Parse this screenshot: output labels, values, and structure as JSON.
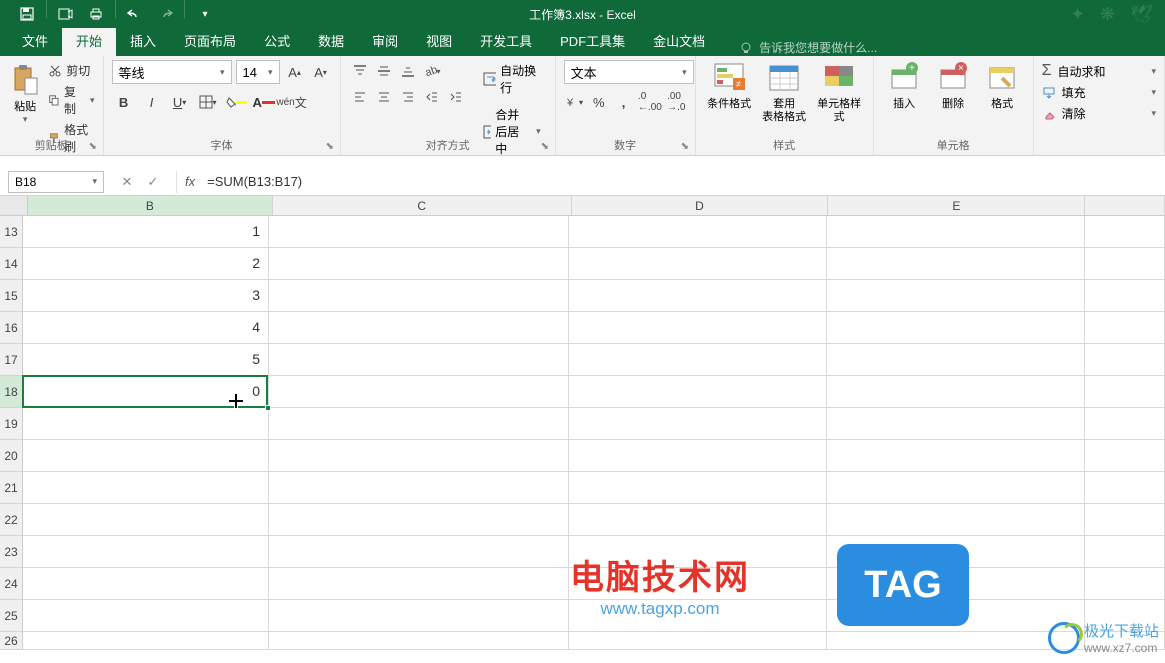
{
  "title": "工作簿3.xlsx - Excel",
  "tabs": {
    "file": "文件",
    "home": "开始",
    "insert": "插入",
    "layout": "页面布局",
    "formula": "公式",
    "data": "数据",
    "review": "审阅",
    "view": "视图",
    "dev": "开发工具",
    "pdf": "PDF工具集",
    "jinshan": "金山文档"
  },
  "tell_me": "告诉我您想要做什么...",
  "ribbon": {
    "clipboard": {
      "label": "剪贴板",
      "paste": "粘贴",
      "cut": "剪切",
      "copy": "复制",
      "format": "格式刷"
    },
    "font": {
      "label": "字体",
      "name": "等线",
      "size": "14"
    },
    "align": {
      "label": "对齐方式",
      "wrap": "自动换行",
      "merge": "合并后居中"
    },
    "number": {
      "label": "数字",
      "format": "文本"
    },
    "styles": {
      "label": "样式",
      "cond": "条件格式",
      "table": "套用\n表格格式",
      "cell": "单元格样式"
    },
    "cells": {
      "label": "单元格",
      "insert": "插入",
      "delete": "删除",
      "format": "格式"
    },
    "editing": {
      "sum": "自动求和",
      "fill": "填充",
      "clear": "清除"
    }
  },
  "formula_bar": {
    "name_box": "B18",
    "formula": "=SUM(B13:B17)"
  },
  "columns": [
    "B",
    "C",
    "D",
    "E"
  ],
  "rows": [
    13,
    14,
    15,
    16,
    17,
    18,
    19,
    20,
    21,
    22,
    23,
    24,
    25,
    26
  ],
  "cells": {
    "B13": "1",
    "B14": "2",
    "B15": "3",
    "B16": "4",
    "B17": "5",
    "B18": "0"
  },
  "selection": {
    "cell": "B18",
    "row": 18,
    "col": "B"
  },
  "watermarks": {
    "wm1_title": "电脑技术网",
    "wm1_url": "www.tagxp.com",
    "tag": "TAG",
    "wm2_title": "极光下载站",
    "wm2_url": "www.xz7.com"
  }
}
